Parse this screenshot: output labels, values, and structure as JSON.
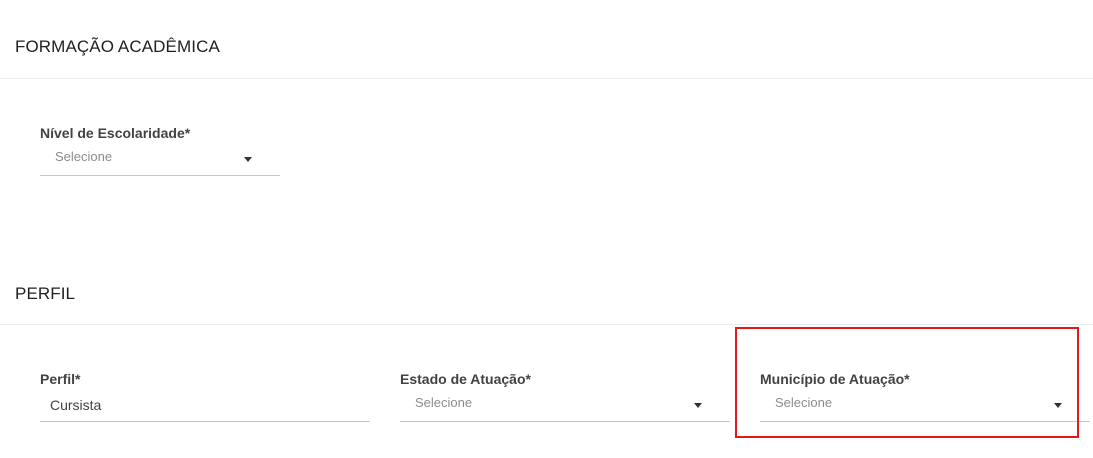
{
  "sections": {
    "formacao": {
      "title": "FORMAÇÃO ACADÊMICA",
      "nivel": {
        "label": "Nível de Escolaridade*",
        "value": "Selecione"
      }
    },
    "perfil": {
      "title": "PERFIL",
      "perfil_field": {
        "label": "Perfil*",
        "value": "Cursista"
      },
      "estado": {
        "label": "Estado de Atuação*",
        "value": "Selecione"
      },
      "municipio": {
        "label": "Município de Atuação*",
        "value": "Selecione"
      }
    }
  },
  "colors": {
    "highlight": "#e01919",
    "divider": "#ececec"
  },
  "icons": {
    "dropdown": "caret-down-icon"
  }
}
